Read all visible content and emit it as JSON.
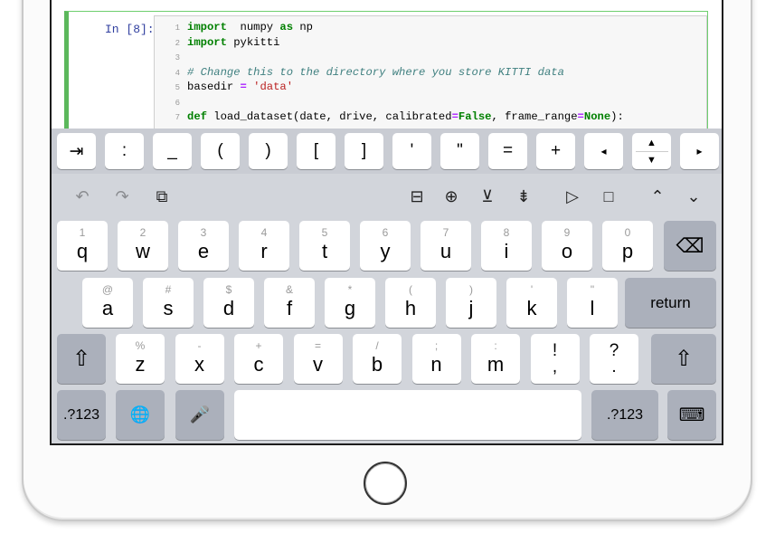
{
  "notebook": {
    "prompt": "In [8]:",
    "lines": [
      {
        "n": "1",
        "parts": [
          [
            "kw",
            "import"
          ],
          [
            "",
            "  numpy "
          ],
          [
            "kw",
            "as"
          ],
          [
            "",
            " np"
          ]
        ]
      },
      {
        "n": "2",
        "parts": [
          [
            "kw",
            "import"
          ],
          [
            "",
            ""
          ],
          [
            "",
            " pykitti"
          ]
        ]
      },
      {
        "n": "3",
        "parts": []
      },
      {
        "n": "4",
        "parts": [
          [
            "cm",
            "# Change this to the directory where you store KITTI data"
          ]
        ]
      },
      {
        "n": "5",
        "parts": [
          [
            "",
            "basedir "
          ],
          [
            "op",
            "="
          ],
          [
            "",
            " "
          ],
          [
            "st",
            "'data'"
          ]
        ]
      },
      {
        "n": "6",
        "parts": []
      },
      {
        "n": "7",
        "parts": [
          [
            "kw",
            "def"
          ],
          [
            "",
            " load_dataset(date, drive, calibrated"
          ],
          [
            "op",
            "="
          ],
          [
            "kc",
            "False"
          ],
          [
            "",
            ", frame_range"
          ],
          [
            "op",
            "="
          ],
          [
            "kc",
            "None"
          ],
          [
            "",
            "):"
          ]
        ]
      }
    ]
  },
  "accessory_keys": [
    {
      "label": "⇥",
      "name": "tab-key"
    },
    {
      "label": ":",
      "name": "colon-key"
    },
    {
      "label": "_",
      "name": "underscore-key"
    },
    {
      "label": "(",
      "name": "open-paren-key"
    },
    {
      "label": ")",
      "name": "close-paren-key"
    },
    {
      "label": "[",
      "name": "open-bracket-key"
    },
    {
      "label": "]",
      "name": "close-bracket-key"
    },
    {
      "label": "'",
      "name": "single-quote-key"
    },
    {
      "label": "\"",
      "name": "double-quote-key"
    },
    {
      "label": "=",
      "name": "equals-key"
    },
    {
      "label": "+",
      "name": "plus-key"
    },
    {
      "label": "◂",
      "name": "cursor-left-key"
    },
    {
      "label": "▴▾",
      "name": "cursor-up-down-key"
    },
    {
      "label": "▸",
      "name": "cursor-right-key"
    }
  ],
  "toolbar": {
    "undo": "↶",
    "redo": "↷",
    "paste": "⧉",
    "split": "⊟",
    "insert_above": "⊕",
    "insert_below": "⊻",
    "move": "⇟",
    "run": "▷",
    "stop": "□",
    "up": "⌃",
    "down": "⌄"
  },
  "rows": {
    "row1": [
      {
        "hint": "1",
        "main": "q"
      },
      {
        "hint": "2",
        "main": "w"
      },
      {
        "hint": "3",
        "main": "e"
      },
      {
        "hint": "4",
        "main": "r"
      },
      {
        "hint": "5",
        "main": "t"
      },
      {
        "hint": "6",
        "main": "y"
      },
      {
        "hint": "7",
        "main": "u"
      },
      {
        "hint": "8",
        "main": "i"
      },
      {
        "hint": "9",
        "main": "o"
      },
      {
        "hint": "0",
        "main": "p"
      }
    ],
    "row2": [
      {
        "hint": "@",
        "main": "a"
      },
      {
        "hint": "#",
        "main": "s"
      },
      {
        "hint": "$",
        "main": "d"
      },
      {
        "hint": "&",
        "main": "f"
      },
      {
        "hint": "*",
        "main": "g"
      },
      {
        "hint": "(",
        "main": "h"
      },
      {
        "hint": ")",
        "main": "j"
      },
      {
        "hint": "'",
        "main": "k"
      },
      {
        "hint": "\"",
        "main": "l"
      }
    ],
    "row3": [
      {
        "hint": "%",
        "main": "z"
      },
      {
        "hint": "-",
        "main": "x"
      },
      {
        "hint": "+",
        "main": "c"
      },
      {
        "hint": "=",
        "main": "v"
      },
      {
        "hint": "/",
        "main": "b"
      },
      {
        "hint": ";",
        "main": "n"
      },
      {
        "hint": ":",
        "main": "m"
      },
      {
        "hint": "!",
        "main": ","
      },
      {
        "hint": "?",
        "main": "."
      }
    ]
  },
  "special": {
    "backspace": "⌫",
    "return": "return",
    "shift": "⇧",
    "numbers": ".?123",
    "globe": "🌐",
    "mic": "🎤",
    "hide": "⌨"
  }
}
